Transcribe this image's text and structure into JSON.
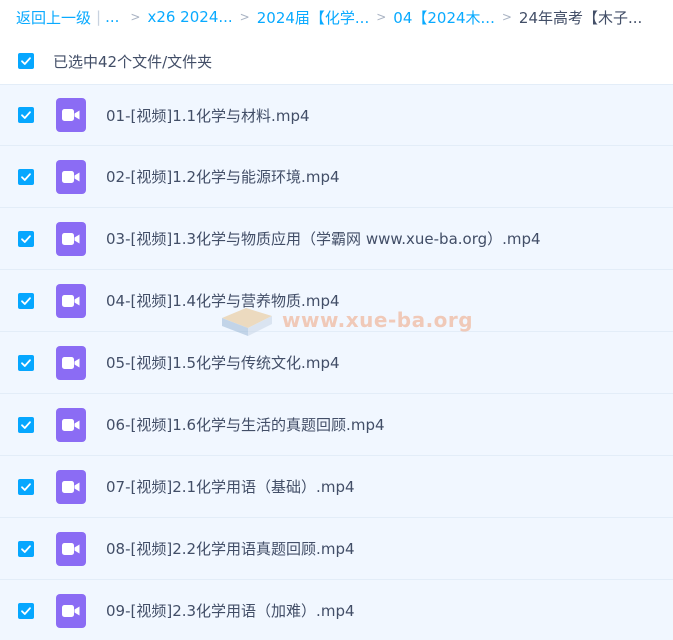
{
  "breadcrumb": {
    "back": "返回上一级",
    "separator": "|",
    "ellipsis": "...",
    "arrow": ">",
    "items": [
      "x26 2024...",
      "2024届【化学...",
      "04【2024木..."
    ],
    "current": "24年高考【木子..."
  },
  "selection": {
    "label": "已选中42个文件/文件夹",
    "checked": true
  },
  "files": [
    {
      "name": "01-[视频]1.1化学与材料.mp4",
      "checked": true
    },
    {
      "name": "02-[视频]1.2化学与能源环境.mp4",
      "checked": true
    },
    {
      "name": "03-[视频]1.3化学与物质应用（学霸网 www.xue-ba.org）.mp4",
      "checked": true
    },
    {
      "name": "04-[视频]1.4化学与营养物质.mp4",
      "checked": true
    },
    {
      "name": "05-[视频]1.5化学与传统文化.mp4",
      "checked": true
    },
    {
      "name": "06-[视频]1.6化学与生活的真题回顾.mp4",
      "checked": true
    },
    {
      "name": "07-[视频]2.1化学用语（基础）.mp4",
      "checked": true
    },
    {
      "name": "08-[视频]2.2化学用语真题回顾.mp4",
      "checked": true
    },
    {
      "name": "09-[视频]2.3化学用语（加难）.mp4",
      "checked": true
    }
  ],
  "watermark": {
    "text": "www.xue-ba.org"
  },
  "icons": {
    "checkbox": "check-icon",
    "file": "video-file-icon"
  },
  "colors": {
    "accent": "#06a7ff",
    "video_icon": "#8b6cf4",
    "row_bg": "#f1f7ff",
    "text": "#424e67"
  }
}
